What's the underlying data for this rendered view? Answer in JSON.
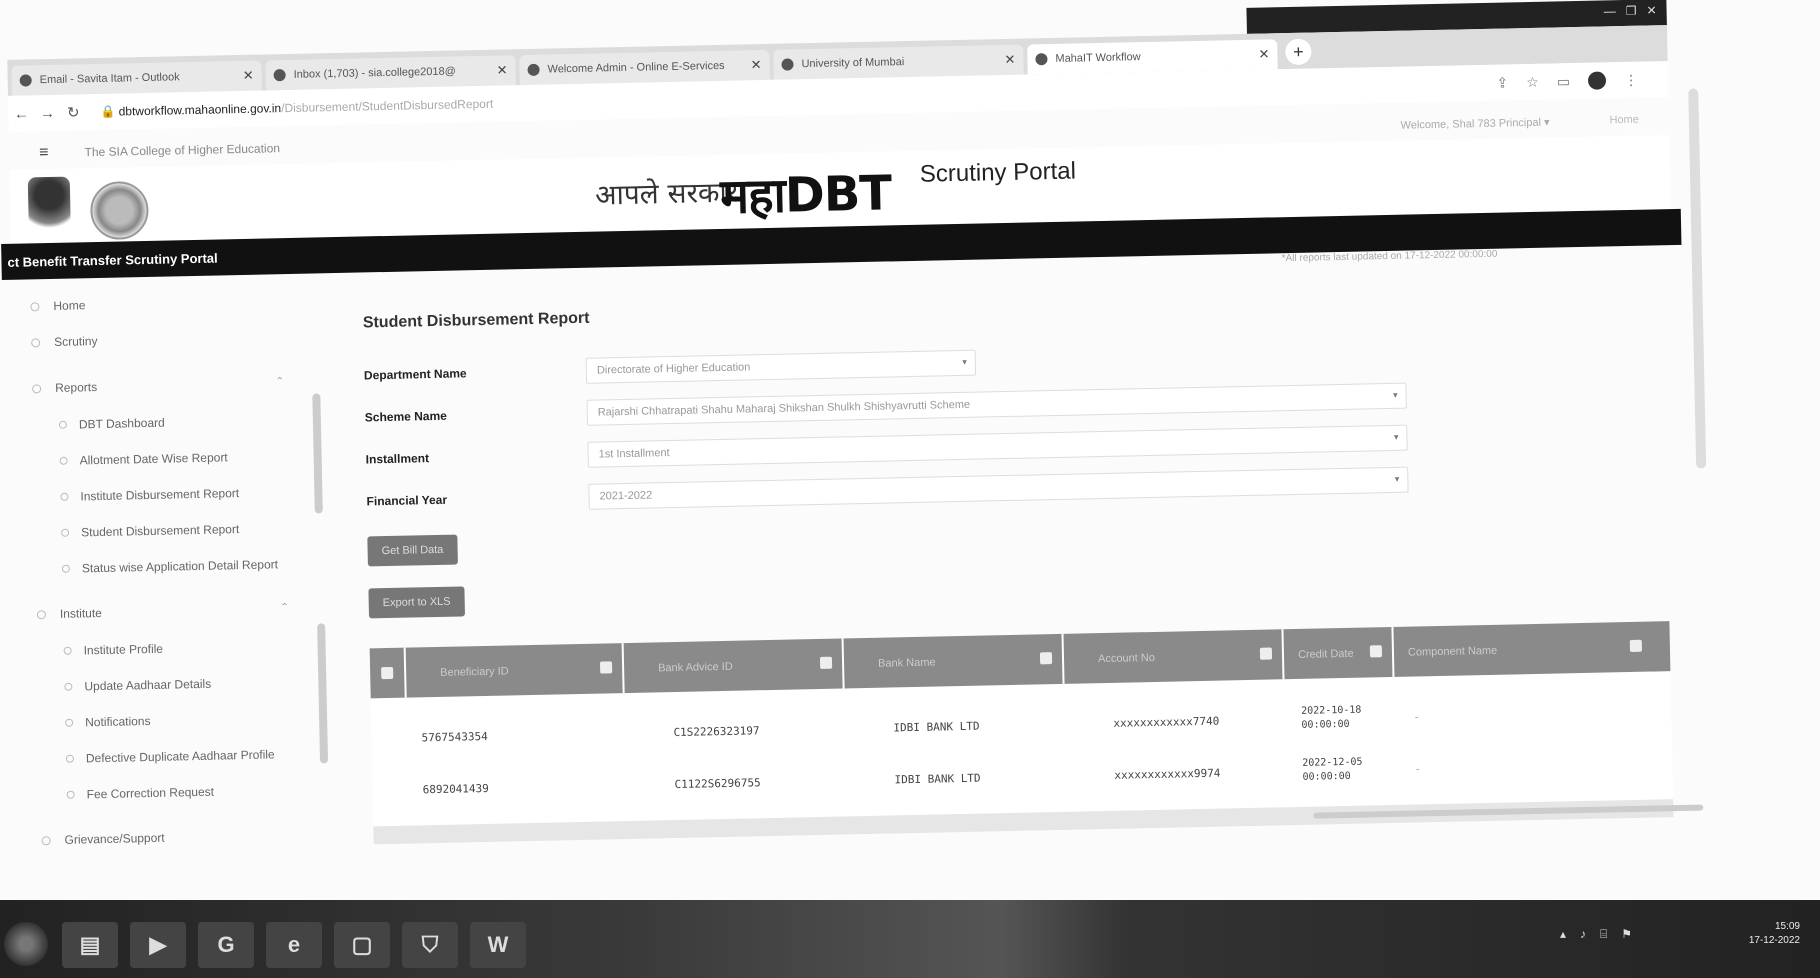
{
  "browser": {
    "tabs": [
      {
        "label": "Email - Savita Itam - Outlook",
        "active": false
      },
      {
        "label": "Inbox (1,703) - sia.college2018@",
        "active": false
      },
      {
        "label": "Welcome Admin - Online E-Services",
        "active": false
      },
      {
        "label": "University of Mumbai",
        "active": false
      },
      {
        "label": "MahaIT Workflow",
        "active": true
      }
    ],
    "url_host": "dbtworkflow.mahaonline.gov.in",
    "url_path": "/Disbursement/StudentDisbursedReport"
  },
  "header": {
    "college_name": "The SIA College of Higher Education",
    "welcome": "Welcome, Shal 783 Principal ▾",
    "home_link": "Home",
    "aple_sarkar": "आपले सरकार",
    "brand": "महाDBT",
    "portal_title": "Scrutiny Portal",
    "bar_title": "ct Benefit Transfer Scrutiny Portal",
    "last_updated": "*All reports last updated on 17-12-2022 00:00:00"
  },
  "sidebar": {
    "home": "Home",
    "scrutiny": "Scrutiny",
    "reports": "Reports",
    "report_items": [
      "DBT Dashboard",
      "Allotment Date Wise Report",
      "Institute Disbursement Report",
      "Student Disbursement Report",
      "Status wise Application Detail Report"
    ],
    "institute": "Institute",
    "institute_items": [
      "Institute Profile",
      "Update Aadhaar Details",
      "Notifications",
      "Defective Duplicate Aadhaar Profile",
      "Fee Correction Request"
    ],
    "grievance": "Grievance/Support"
  },
  "main": {
    "title": "Student Disbursement Report",
    "fields": {
      "department_label": "Department Name",
      "department_value": "Directorate of Higher Education",
      "scheme_label": "Scheme Name",
      "scheme_value": "Rajarshi Chhatrapati Shahu Maharaj Shikshan Shulkh Shishyavrutti Scheme",
      "installment_label": "Installment",
      "installment_value": "1st Installment",
      "year_label": "Financial Year",
      "year_value": "2021-2022"
    },
    "get_bill_button": "Get Bill Data",
    "export_button": "Export to XLS",
    "table": {
      "columns": [
        "Beneficiary ID",
        "Bank Advice ID",
        "Bank Name",
        "Account No",
        "Credit Date",
        "Component Name"
      ],
      "rows": [
        [
          "5767543354",
          "C1S2226323197",
          "IDBI BANK LTD",
          "xxxxxxxxxxxx7740",
          "2022-10-18 00:00:00",
          "-"
        ],
        [
          "6892041439",
          "C1122S6296755",
          "IDBI BANK LTD",
          "xxxxxxxxxxxx9974",
          "2022-12-05 00:00:00",
          "-"
        ]
      ]
    }
  },
  "taskbar": {
    "time": "15:09",
    "date": "17-12-2022"
  }
}
